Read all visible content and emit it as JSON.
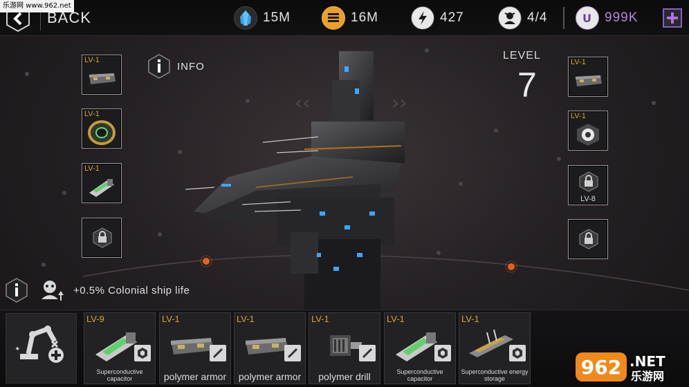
{
  "watermark": "乐游网 www.962.net",
  "header": {
    "back_label": "BACK",
    "resources": [
      {
        "icon": "crystal-icon",
        "value": "15M"
      },
      {
        "icon": "gold-bar-icon",
        "value": "16M"
      },
      {
        "icon": "energy-bolt-icon",
        "value": "427"
      },
      {
        "icon": "crew-icon",
        "value": "4/4"
      }
    ],
    "premium": {
      "icon": "premium-currency-icon",
      "value": "999K"
    }
  },
  "info_label": "INFO",
  "level": {
    "label": "LEVEL",
    "value": "7"
  },
  "left_slots": [
    {
      "level": "LV-1",
      "item": "armor-plate"
    },
    {
      "level": "LV-1",
      "item": "ring-generator"
    },
    {
      "level": "LV-1",
      "item": "capacitor"
    },
    {
      "level": "",
      "item": "locked"
    }
  ],
  "right_slots": [
    {
      "level": "LV-1",
      "item": "armor-plate"
    },
    {
      "level": "LV-1",
      "item": "reactor"
    },
    {
      "level": "",
      "item": "locked",
      "requirement": "LV-8"
    },
    {
      "level": "",
      "item": "locked"
    }
  ],
  "bonus_text": "+0.5% Colonial ship life",
  "inventory": [
    {
      "level": "LV-9",
      "name": "Superconductive capacitor",
      "type": "hexagon"
    },
    {
      "level": "LV-1",
      "name": "polymer armor",
      "type": "slash"
    },
    {
      "level": "LV-1",
      "name": "polymer armor",
      "type": "slash"
    },
    {
      "level": "LV-1",
      "name": "polymer drill",
      "type": "slash"
    },
    {
      "level": "LV-1",
      "name": "Superconductive capacitor",
      "type": "hexagon"
    },
    {
      "level": "LV-1",
      "name": "Superconductive energy storage",
      "type": "hexagon"
    }
  ],
  "site_logo": {
    "number": "962",
    "suffix": ".NET",
    "chinese": "乐游网"
  },
  "colors": {
    "level_gold": "#d9a52e",
    "premium_purple": "#8a5dc2",
    "orange_node": "#e0621e"
  }
}
